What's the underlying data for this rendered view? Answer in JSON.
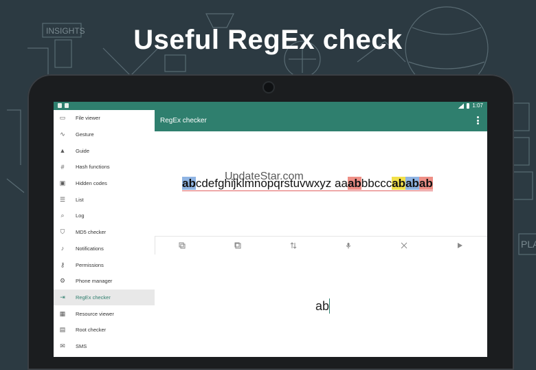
{
  "headline": "Useful RegEx check",
  "background": {
    "doodle_text_1": "INSIGHTS",
    "doodle_text_2": "PLA"
  },
  "statusbar": {
    "time": "1:07"
  },
  "drawer": {
    "items": [
      {
        "label": "File viewer",
        "icon": "folder-icon"
      },
      {
        "label": "Gesture",
        "icon": "gesture-icon"
      },
      {
        "label": "Guide",
        "icon": "graduation-cap-icon"
      },
      {
        "label": "Hash functions",
        "icon": "hash-icon"
      },
      {
        "label": "Hidden codes",
        "icon": "hidden-codes-icon"
      },
      {
        "label": "List",
        "icon": "list-icon"
      },
      {
        "label": "Log",
        "icon": "search-log-icon"
      },
      {
        "label": "MD5 checker",
        "icon": "shield-check-icon"
      },
      {
        "label": "Notifications",
        "icon": "bell-icon"
      },
      {
        "label": "Permissions",
        "icon": "key-icon"
      },
      {
        "label": "Phone manager",
        "icon": "gear-icon"
      },
      {
        "label": "RegEx checker",
        "icon": "regex-icon"
      },
      {
        "label": "Resource viewer",
        "icon": "image-icon"
      },
      {
        "label": "Root checker",
        "icon": "root-icon"
      },
      {
        "label": "SMS",
        "icon": "sms-icon"
      }
    ],
    "active_index": 11
  },
  "appbar": {
    "title": "RegEx checker"
  },
  "test_area": {
    "watermark": "UpdateStar.com",
    "segments": [
      {
        "text": "ab",
        "match": "blue"
      },
      {
        "text": "cdefghijklmnopqrstuvwxyz",
        "match": "none"
      },
      {
        "text": " aa",
        "match": "none"
      },
      {
        "text": "ab",
        "match": "red"
      },
      {
        "text": "bbccc",
        "match": "none"
      },
      {
        "text": "ab",
        "match": "yellow"
      },
      {
        "text": "ab",
        "match": "blue"
      },
      {
        "text": "ab",
        "match": "red"
      }
    ]
  },
  "toolbar": {
    "buttons": [
      {
        "name": "copy-test-button",
        "icon": "copy-icon"
      },
      {
        "name": "paste-button",
        "icon": "paste-icon"
      },
      {
        "name": "swap-button",
        "icon": "swap-icon"
      },
      {
        "name": "voice-input-button",
        "icon": "microphone-icon"
      },
      {
        "name": "clear-button",
        "icon": "close-icon"
      },
      {
        "name": "run-button",
        "icon": "play-icon"
      }
    ]
  },
  "regex": {
    "value": "ab"
  },
  "colors": {
    "primary": "#2f7f6e",
    "match_blue": "#8fb4e3",
    "match_red": "#ee8f86",
    "match_yellow": "#f2e04a"
  }
}
